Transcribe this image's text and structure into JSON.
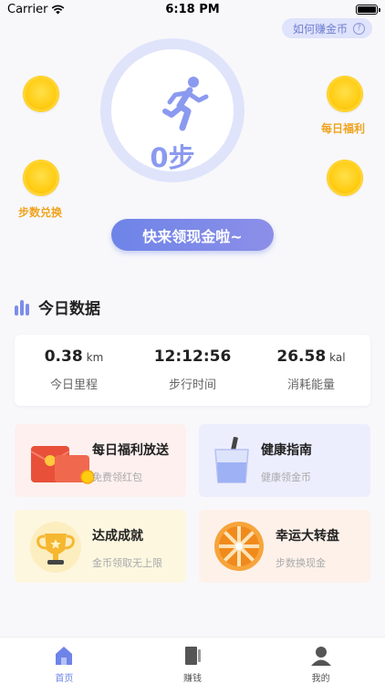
{
  "status_bar": {
    "carrier": "Carrier",
    "time": "6:18 PM"
  },
  "header": {
    "earn_tip": "如何赚金币",
    "help_icon": "?"
  },
  "step_ring": {
    "steps": "0步"
  },
  "coins": {
    "daily_welfare_label": "每日福利",
    "step_exchange_label": "步数兑换"
  },
  "collect_button": {
    "label": "快来领现金啦~"
  },
  "today": {
    "title": "今日数据",
    "stats": [
      {
        "value": "0.38",
        "unit": "km",
        "label": "今日里程"
      },
      {
        "value": "12:12:56",
        "unit": "",
        "label": "步行时间"
      },
      {
        "value": "26.58",
        "unit": "kal",
        "label": "消耗能量"
      }
    ]
  },
  "features": [
    {
      "title": "每日福利放送",
      "subtitle": "免费领红包",
      "bg": "#fdf0ef"
    },
    {
      "title": "健康指南",
      "subtitle": "健康领金币",
      "bg": "#eceefd"
    },
    {
      "title": "达成成就",
      "subtitle": "金币领取无上限",
      "bg": "#fdf7e0"
    },
    {
      "title": "幸运大转盘",
      "subtitle": "步数换现金",
      "bg": "#fdf1ea"
    }
  ],
  "tab_bar": {
    "tabs": [
      {
        "label": "首页",
        "icon": "home-icon"
      },
      {
        "label": "赚钱",
        "icon": "wallet-icon"
      },
      {
        "label": "我的",
        "icon": "profile-icon"
      }
    ]
  },
  "colors": {
    "accent": "#6e84e8",
    "coin_gold": "#ffcc12",
    "coin_label": "#f0a31e"
  }
}
